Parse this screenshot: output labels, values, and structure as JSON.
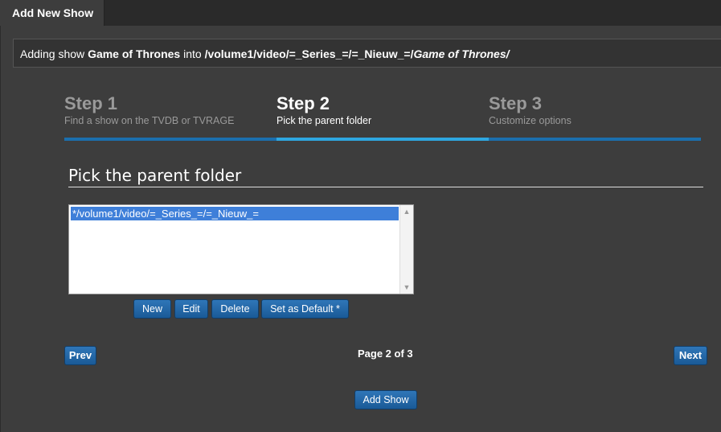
{
  "tab": {
    "title": "Add New Show"
  },
  "info": {
    "prefix": "Adding show ",
    "show_name": "Game of Thrones",
    "middle": " into ",
    "path": "/volume1/video/=_Series_=/=_Nieuw_=/",
    "path_show": "Game of Thrones/"
  },
  "steps": [
    {
      "num": "Step 1",
      "desc": "Find a show on the TVDB or TVRAGE",
      "active": false
    },
    {
      "num": "Step 2",
      "desc": "Pick the parent folder",
      "active": true
    },
    {
      "num": "Step 3",
      "desc": "Customize options",
      "active": false
    }
  ],
  "section": {
    "title": "Pick the parent folder"
  },
  "folders": {
    "items": [
      "*/volume1/video/=_Series_=/=_Nieuw_="
    ]
  },
  "folder_buttons": {
    "new": "New",
    "edit": "Edit",
    "delete": "Delete",
    "set_default": "Set as Default *"
  },
  "pager": {
    "prev": "Prev",
    "page": "Page 2 of 3",
    "next": "Next"
  },
  "submit": {
    "label": "Add Show"
  }
}
